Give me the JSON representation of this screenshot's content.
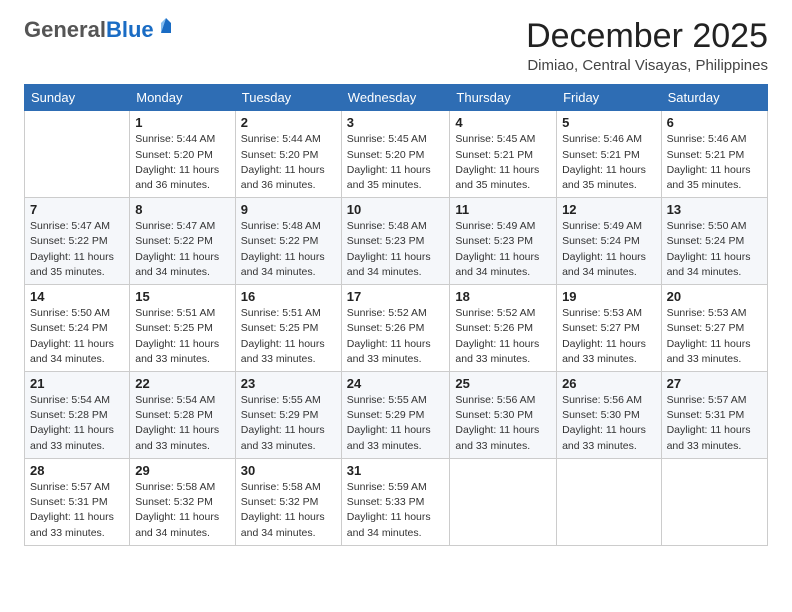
{
  "header": {
    "logo_general": "General",
    "logo_blue": "Blue",
    "month_title": "December 2025",
    "location": "Dimiao, Central Visayas, Philippines"
  },
  "days_of_week": [
    "Sunday",
    "Monday",
    "Tuesday",
    "Wednesday",
    "Thursday",
    "Friday",
    "Saturday"
  ],
  "weeks": [
    [
      {
        "day": "",
        "info": ""
      },
      {
        "day": "1",
        "info": "Sunrise: 5:44 AM\nSunset: 5:20 PM\nDaylight: 11 hours and 36 minutes."
      },
      {
        "day": "2",
        "info": "Sunrise: 5:44 AM\nSunset: 5:20 PM\nDaylight: 11 hours and 36 minutes."
      },
      {
        "day": "3",
        "info": "Sunrise: 5:45 AM\nSunset: 5:20 PM\nDaylight: 11 hours and 35 minutes."
      },
      {
        "day": "4",
        "info": "Sunrise: 5:45 AM\nSunset: 5:21 PM\nDaylight: 11 hours and 35 minutes."
      },
      {
        "day": "5",
        "info": "Sunrise: 5:46 AM\nSunset: 5:21 PM\nDaylight: 11 hours and 35 minutes."
      },
      {
        "day": "6",
        "info": "Sunrise: 5:46 AM\nSunset: 5:21 PM\nDaylight: 11 hours and 35 minutes."
      }
    ],
    [
      {
        "day": "7",
        "info": "Sunrise: 5:47 AM\nSunset: 5:22 PM\nDaylight: 11 hours and 35 minutes."
      },
      {
        "day": "8",
        "info": "Sunrise: 5:47 AM\nSunset: 5:22 PM\nDaylight: 11 hours and 34 minutes."
      },
      {
        "day": "9",
        "info": "Sunrise: 5:48 AM\nSunset: 5:22 PM\nDaylight: 11 hours and 34 minutes."
      },
      {
        "day": "10",
        "info": "Sunrise: 5:48 AM\nSunset: 5:23 PM\nDaylight: 11 hours and 34 minutes."
      },
      {
        "day": "11",
        "info": "Sunrise: 5:49 AM\nSunset: 5:23 PM\nDaylight: 11 hours and 34 minutes."
      },
      {
        "day": "12",
        "info": "Sunrise: 5:49 AM\nSunset: 5:24 PM\nDaylight: 11 hours and 34 minutes."
      },
      {
        "day": "13",
        "info": "Sunrise: 5:50 AM\nSunset: 5:24 PM\nDaylight: 11 hours and 34 minutes."
      }
    ],
    [
      {
        "day": "14",
        "info": "Sunrise: 5:50 AM\nSunset: 5:24 PM\nDaylight: 11 hours and 34 minutes."
      },
      {
        "day": "15",
        "info": "Sunrise: 5:51 AM\nSunset: 5:25 PM\nDaylight: 11 hours and 33 minutes."
      },
      {
        "day": "16",
        "info": "Sunrise: 5:51 AM\nSunset: 5:25 PM\nDaylight: 11 hours and 33 minutes."
      },
      {
        "day": "17",
        "info": "Sunrise: 5:52 AM\nSunset: 5:26 PM\nDaylight: 11 hours and 33 minutes."
      },
      {
        "day": "18",
        "info": "Sunrise: 5:52 AM\nSunset: 5:26 PM\nDaylight: 11 hours and 33 minutes."
      },
      {
        "day": "19",
        "info": "Sunrise: 5:53 AM\nSunset: 5:27 PM\nDaylight: 11 hours and 33 minutes."
      },
      {
        "day": "20",
        "info": "Sunrise: 5:53 AM\nSunset: 5:27 PM\nDaylight: 11 hours and 33 minutes."
      }
    ],
    [
      {
        "day": "21",
        "info": "Sunrise: 5:54 AM\nSunset: 5:28 PM\nDaylight: 11 hours and 33 minutes."
      },
      {
        "day": "22",
        "info": "Sunrise: 5:54 AM\nSunset: 5:28 PM\nDaylight: 11 hours and 33 minutes."
      },
      {
        "day": "23",
        "info": "Sunrise: 5:55 AM\nSunset: 5:29 PM\nDaylight: 11 hours and 33 minutes."
      },
      {
        "day": "24",
        "info": "Sunrise: 5:55 AM\nSunset: 5:29 PM\nDaylight: 11 hours and 33 minutes."
      },
      {
        "day": "25",
        "info": "Sunrise: 5:56 AM\nSunset: 5:30 PM\nDaylight: 11 hours and 33 minutes."
      },
      {
        "day": "26",
        "info": "Sunrise: 5:56 AM\nSunset: 5:30 PM\nDaylight: 11 hours and 33 minutes."
      },
      {
        "day": "27",
        "info": "Sunrise: 5:57 AM\nSunset: 5:31 PM\nDaylight: 11 hours and 33 minutes."
      }
    ],
    [
      {
        "day": "28",
        "info": "Sunrise: 5:57 AM\nSunset: 5:31 PM\nDaylight: 11 hours and 33 minutes."
      },
      {
        "day": "29",
        "info": "Sunrise: 5:58 AM\nSunset: 5:32 PM\nDaylight: 11 hours and 34 minutes."
      },
      {
        "day": "30",
        "info": "Sunrise: 5:58 AM\nSunset: 5:32 PM\nDaylight: 11 hours and 34 minutes."
      },
      {
        "day": "31",
        "info": "Sunrise: 5:59 AM\nSunset: 5:33 PM\nDaylight: 11 hours and 34 minutes."
      },
      {
        "day": "",
        "info": ""
      },
      {
        "day": "",
        "info": ""
      },
      {
        "day": "",
        "info": ""
      }
    ]
  ]
}
